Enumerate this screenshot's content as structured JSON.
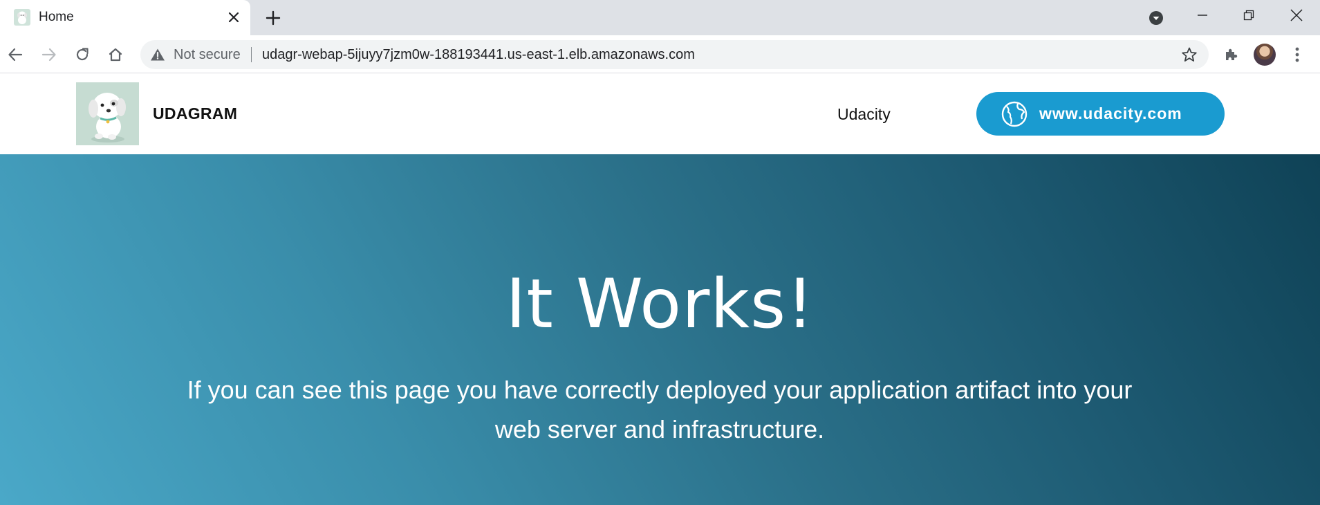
{
  "browser": {
    "tab_title": "Home",
    "omnibox": {
      "security_label": "Not secure",
      "url": "udagr-webap-5ijuyy7jzm0w-188193441.us-east-1.elb.amazonaws.com"
    },
    "icons": [
      "tab-favicon-dog",
      "close-icon",
      "plus-icon",
      "tab-search-icon",
      "minimize-icon",
      "restore-icon",
      "window-close-icon",
      "back-arrow-icon",
      "forward-arrow-icon",
      "reload-icon",
      "home-icon",
      "warning-icon",
      "star-icon",
      "puzzle-icon",
      "kebab-menu-icon"
    ]
  },
  "site": {
    "brand": "UDAGRAM",
    "nav_link": "Udacity",
    "cta_label": "www.udacity.com",
    "cta_icon": "globe-icon",
    "colors": {
      "cta": "#1a9bd0",
      "hero_start": "#4aa8c8",
      "hero_end": "#0f4256"
    }
  },
  "hero": {
    "title": "It Works!",
    "text": "If you can see this page you have correctly deployed your application artifact into your web server and infrastructure."
  }
}
